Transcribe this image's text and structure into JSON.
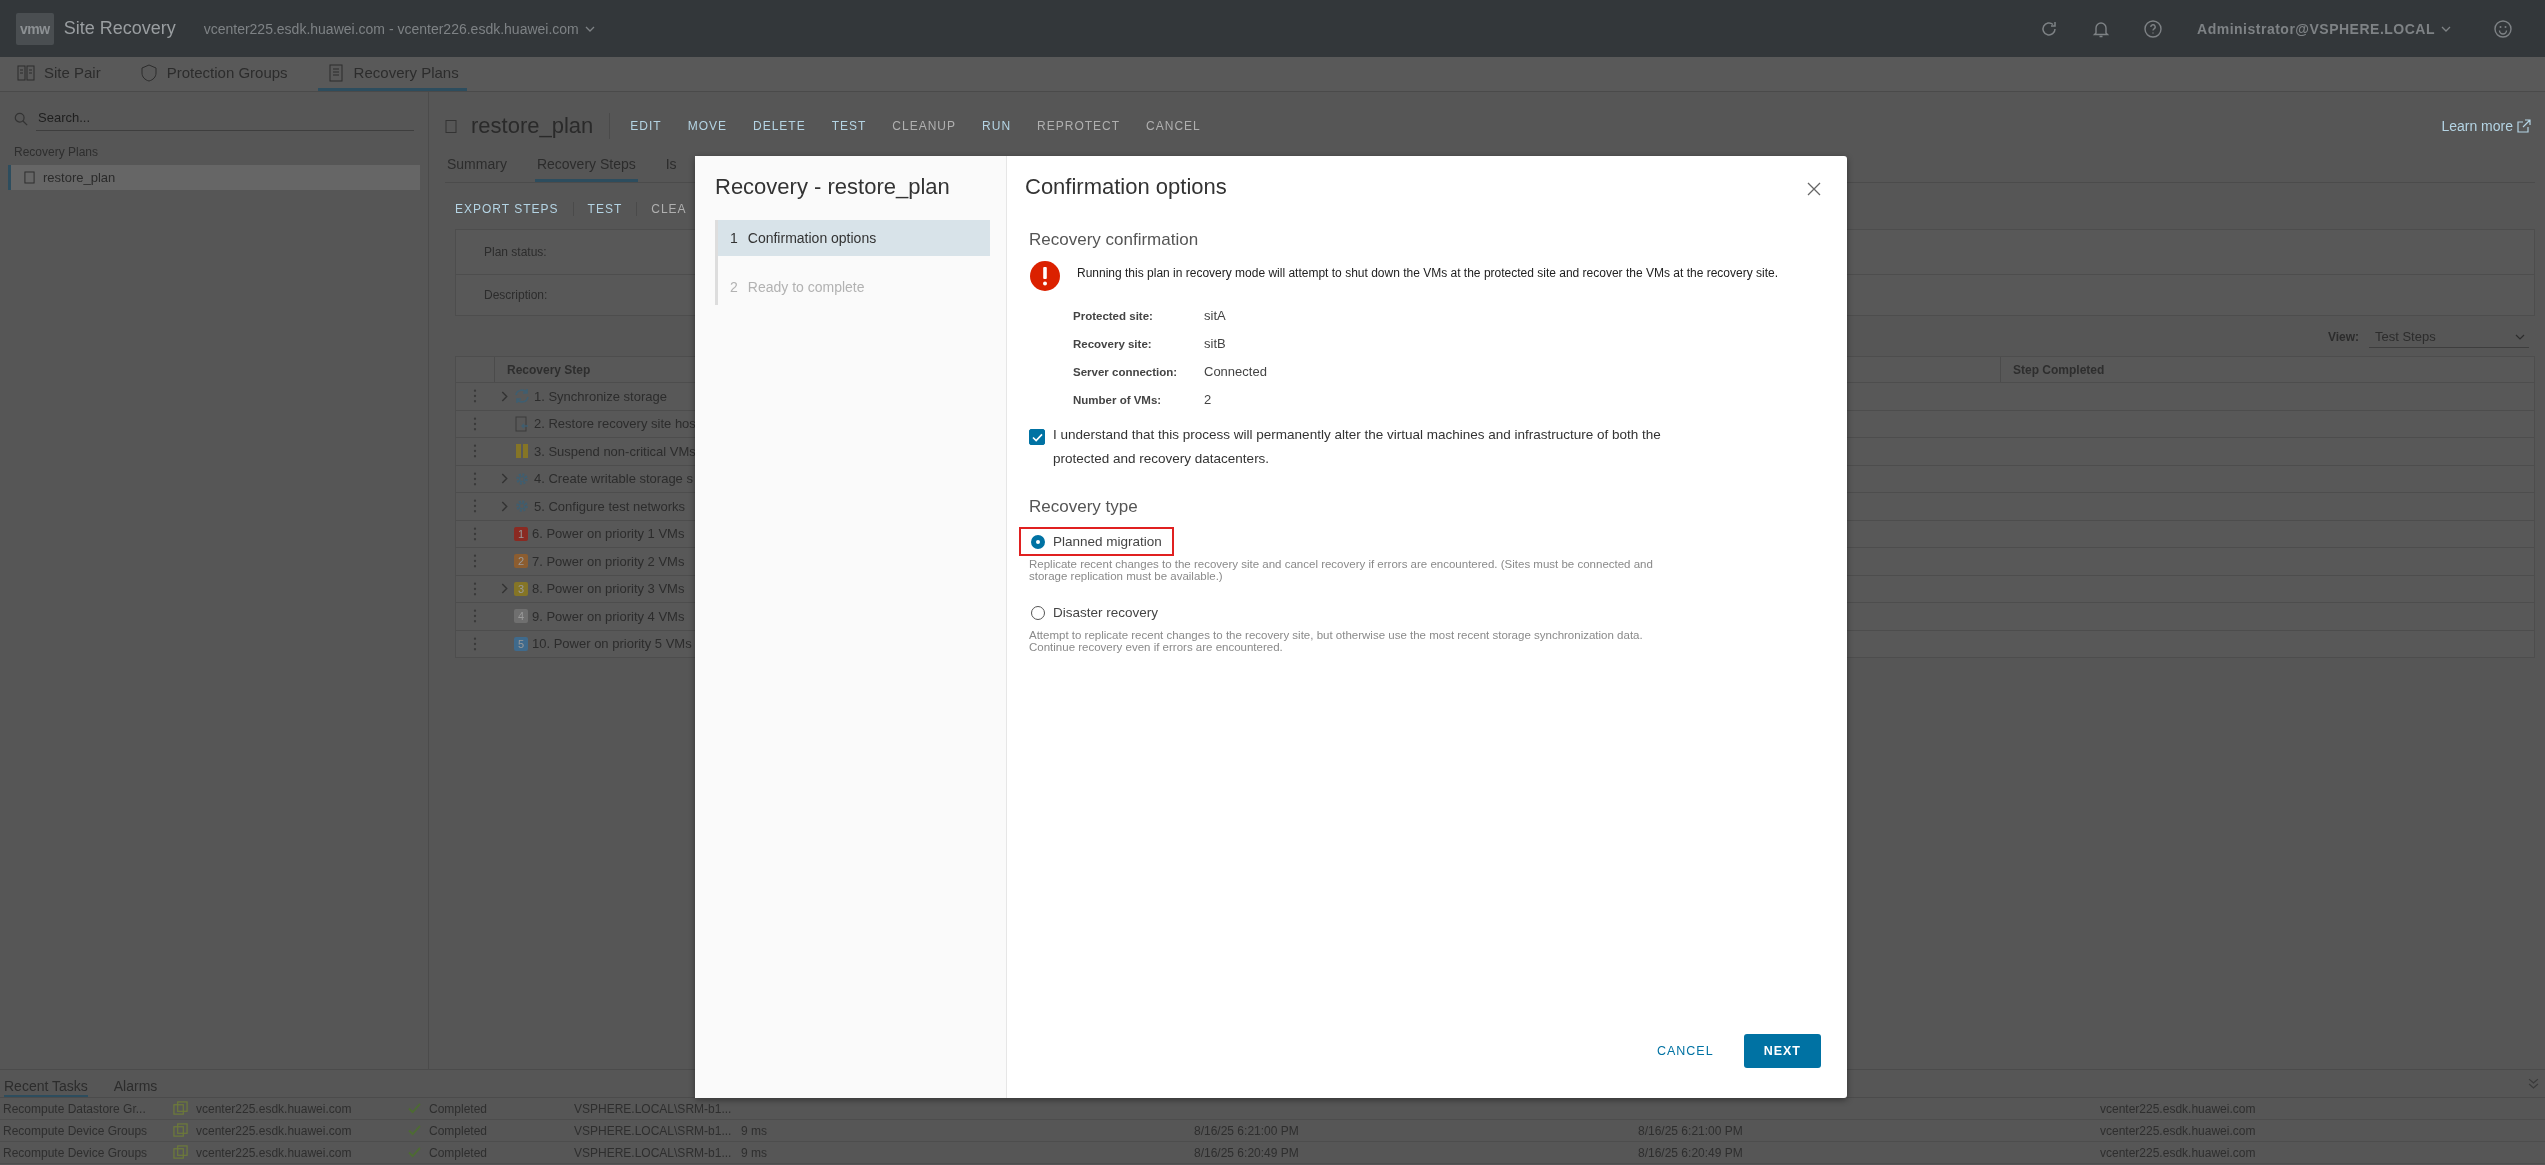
{
  "header": {
    "logo": "vmw",
    "product": "Site Recovery",
    "site_pair": "vcenter225.esdk.huawei.com - vcenter226.esdk.huawei.com",
    "user": "Administrator@VSPHERE.LOCAL"
  },
  "nav_tabs": [
    {
      "label": "Site Pair",
      "kind": "pair",
      "selected": false
    },
    {
      "label": "Protection Groups",
      "kind": "shield",
      "selected": false
    },
    {
      "label": "Recovery Plans",
      "kind": "plan",
      "selected": true
    }
  ],
  "sidebar": {
    "search": {
      "placeholder": "Search..."
    },
    "section": "Recovery Plans",
    "items": [
      {
        "label": "restore_plan",
        "selected": true
      }
    ]
  },
  "plan": {
    "title": "restore_plan",
    "learn_more": "Learn more",
    "actions": [
      {
        "label": "EDIT",
        "disabled": false
      },
      {
        "label": "MOVE",
        "disabled": false
      },
      {
        "label": "DELETE",
        "disabled": false
      },
      {
        "label": "TEST",
        "disabled": false
      },
      {
        "label": "CLEANUP",
        "disabled": true
      },
      {
        "label": "RUN",
        "disabled": false
      },
      {
        "label": "REPROTECT",
        "disabled": true
      },
      {
        "label": "CANCEL",
        "disabled": true
      }
    ],
    "tabs": [
      {
        "label": "Summary",
        "selected": false
      },
      {
        "label": "Recovery Steps",
        "selected": true
      },
      {
        "label": "Is",
        "selected": false
      }
    ],
    "toolbar": [
      {
        "label": "EXPORT STEPS",
        "disabled": false
      },
      {
        "label": "TEST",
        "disabled": false
      },
      {
        "label": "CLEA",
        "disabled": true
      }
    ],
    "fields": [
      {
        "label": "Plan status:"
      },
      {
        "label": "Description:"
      }
    ],
    "view": {
      "label": "View:",
      "value": "Test Steps"
    },
    "table": {
      "columns": [
        "Recovery Step",
        "Step Completed"
      ],
      "rows": [
        {
          "kind": "sync",
          "expandable": true,
          "label": "1. Synchronize storage"
        },
        {
          "kind": "restore",
          "expandable": false,
          "label": "2. Restore recovery site hos"
        },
        {
          "kind": "suspend",
          "expandable": false,
          "label": "3. Suspend non-critical VMs"
        },
        {
          "kind": "gear",
          "expandable": true,
          "label": "4. Create writable storage s"
        },
        {
          "kind": "gear",
          "expandable": true,
          "label": "5. Configure test networks"
        },
        {
          "kind": "priority",
          "expandable": false,
          "badge": "1",
          "color": "#8a2a22",
          "label": "6. Power on priority 1 VMs"
        },
        {
          "kind": "priority",
          "expandable": false,
          "badge": "2",
          "color": "#8c5d30",
          "label": "7. Power on priority 2 VMs"
        },
        {
          "kind": "priority",
          "expandable": true,
          "badge": "3",
          "color": "#857526",
          "label": "8. Power on priority 3 VMs"
        },
        {
          "kind": "priority",
          "expandable": false,
          "badge": "4",
          "color": "#6f6f6f",
          "label": "9. Power on priority 4 VMs"
        },
        {
          "kind": "priority",
          "expandable": false,
          "badge": "5",
          "color": "#3f6a8c",
          "label": "10. Power on priority 5 VMs"
        }
      ]
    }
  },
  "tasks": {
    "tabs": [
      {
        "label": "Recent Tasks",
        "selected": true
      },
      {
        "label": "Alarms",
        "selected": false
      }
    ],
    "rows": [
      {
        "name": "Recompute Datastore Gr...",
        "target": "vcenter225.esdk.huawei.com",
        "status": "Completed",
        "initiator": "VSPHERE.LOCAL\\SRM-b1...",
        "server": "vcenter225.esdk.huawei.com"
      },
      {
        "name": "Recompute Device Groups",
        "target": "vcenter225.esdk.huawei.com",
        "status": "Completed",
        "initiator": "VSPHERE.LOCAL\\SRM-b1...",
        "queued": "9 ms",
        "start": "8/16/25 6:21:00 PM",
        "completion": "8/16/25 6:21:00 PM",
        "server": "vcenter225.esdk.huawei.com"
      },
      {
        "name": "Recompute Device Groups",
        "target": "vcenter225.esdk.huawei.com",
        "status": "Completed",
        "initiator": "VSPHERE.LOCAL\\SRM-b1...",
        "queued": "9 ms",
        "start": "8/16/25 6:20:49 PM",
        "completion": "8/16/25 6:20:49 PM",
        "server": "vcenter225.esdk.huawei.com"
      }
    ]
  },
  "dialog": {
    "title": "Recovery - restore_plan",
    "steps": [
      {
        "number": "1",
        "label": "Confirmation options",
        "selected": true,
        "disabled": false
      },
      {
        "number": "2",
        "label": "Ready to complete",
        "selected": false,
        "disabled": true
      }
    ],
    "page_title": "Confirmation options",
    "section_confirm": "Recovery confirmation",
    "warning": "Running this plan in recovery mode will attempt to shut down the VMs at the protected site and recover the VMs at the recovery site.",
    "details": [
      {
        "label": "Protected site:",
        "value": "sitA"
      },
      {
        "label": "Recovery site:",
        "value": "sitB"
      },
      {
        "label": "Server connection:",
        "value": "Connected"
      },
      {
        "label": "Number of VMs:",
        "value": "2"
      }
    ],
    "consent": {
      "label": "I understand that this process will permanently alter the virtual machines and infrastructure of both the protected and recovery datacenters.",
      "checked": true
    },
    "section_type": "Recovery type",
    "options": [
      {
        "label": "Planned migration",
        "selected": true,
        "highlighted": true,
        "description": "Replicate recent changes to the recovery site and cancel recovery if errors are encountered. (Sites must be connected and storage replication must be available.)"
      },
      {
        "label": "Disaster recovery",
        "selected": false,
        "highlighted": false,
        "description": "Attempt to replicate recent changes to the recovery site, but otherwise use the most recent storage synchronization data. Continue recovery even if errors are encountered."
      }
    ],
    "buttons": [
      {
        "label": "CANCEL",
        "kind": "link"
      },
      {
        "label": "NEXT",
        "kind": "primary"
      }
    ]
  }
}
